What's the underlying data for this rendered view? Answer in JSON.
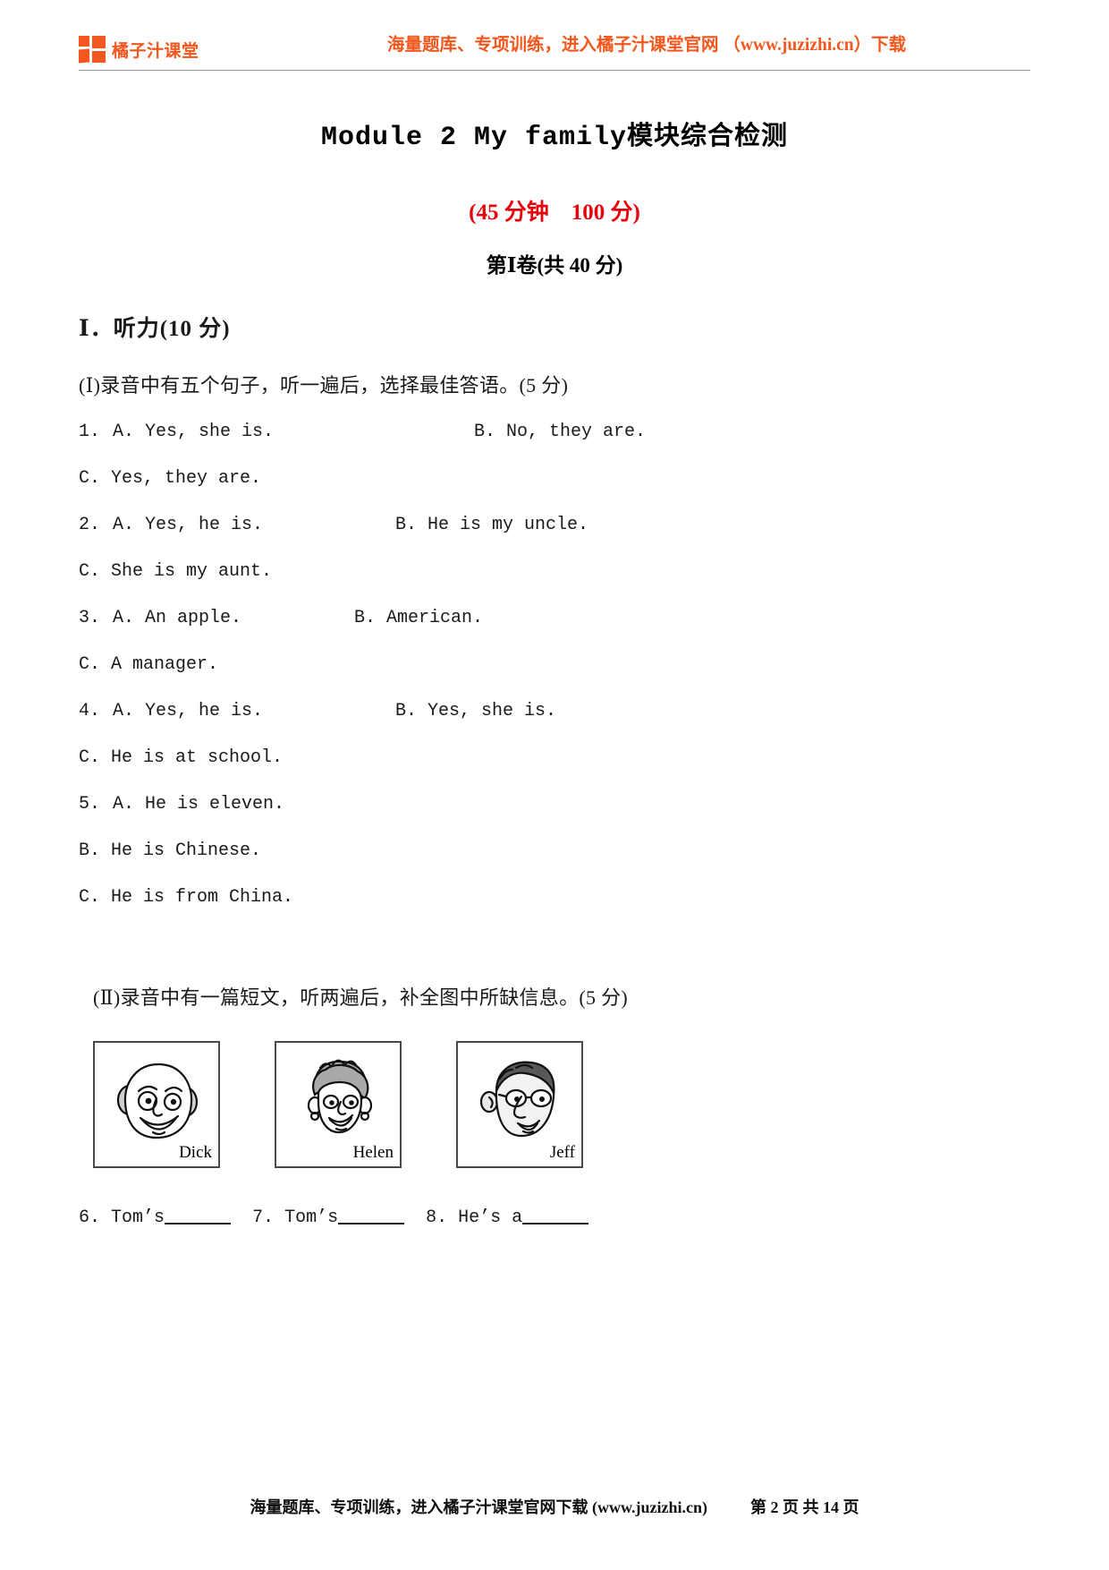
{
  "header": {
    "brand_name": "橘子汁课堂",
    "brand_color": "#f4571d",
    "promo_note": "海量题库、专项训练，进入橘子汁课堂官网 （www.juzizhi.cn）下载"
  },
  "title": {
    "english": "Module 2 My family",
    "chinese": "模块综合检测"
  },
  "score_line": "(45 分钟　100 分)",
  "volume_line": "第Ⅰ卷(共 40 分)",
  "section": {
    "heading": "Ⅰ．听力(10 分)",
    "part1_directive": "(Ⅰ)录音中有五个句子，听一遍后，选择最佳答语。(5 分)",
    "part2_directive": "(Ⅱ)录音中有一篇短文，听两遍后，补全图中所缺信息。(5 分)"
  },
  "questions": [
    {
      "number": "1.",
      "a": "A. Yes, she is.",
      "b": "B. No, they are.",
      "c": "C. Yes, they are."
    },
    {
      "number": "2.",
      "a": "A. Yes, he is.",
      "b": "B. He is my uncle.",
      "c": "C. She is my aunt."
    },
    {
      "number": "3.",
      "a": "A. An apple.",
      "b": "B. American.",
      "c": "C. A manager."
    },
    {
      "number": "4.",
      "a": "A. Yes, he is.",
      "b": "B. Yes, she is.",
      "c": "C. He is at school."
    },
    {
      "number": "5.",
      "a": "A. He is eleven.",
      "b": "B. He is Chinese.",
      "c": "C. He is from China."
    }
  ],
  "picture_cards": [
    {
      "name": "Dick",
      "icon": "face-bald-man-icon"
    },
    {
      "name": "Helen",
      "icon": "face-curly-hair-woman-icon"
    },
    {
      "name": "Jeff",
      "icon": "face-young-man-glasses-icon"
    }
  ],
  "fill_in_items": [
    {
      "number": "6.",
      "stem": "Tom’s"
    },
    {
      "number": "7.",
      "stem": "Tom’s"
    },
    {
      "number": "8.",
      "stem": "He’s a"
    }
  ],
  "footer": {
    "note": "海量题库、专项训练，进入橘子汁课堂官网下载 (www.juzizhi.cn)",
    "page_label": "第 2 页 共 14 页"
  }
}
